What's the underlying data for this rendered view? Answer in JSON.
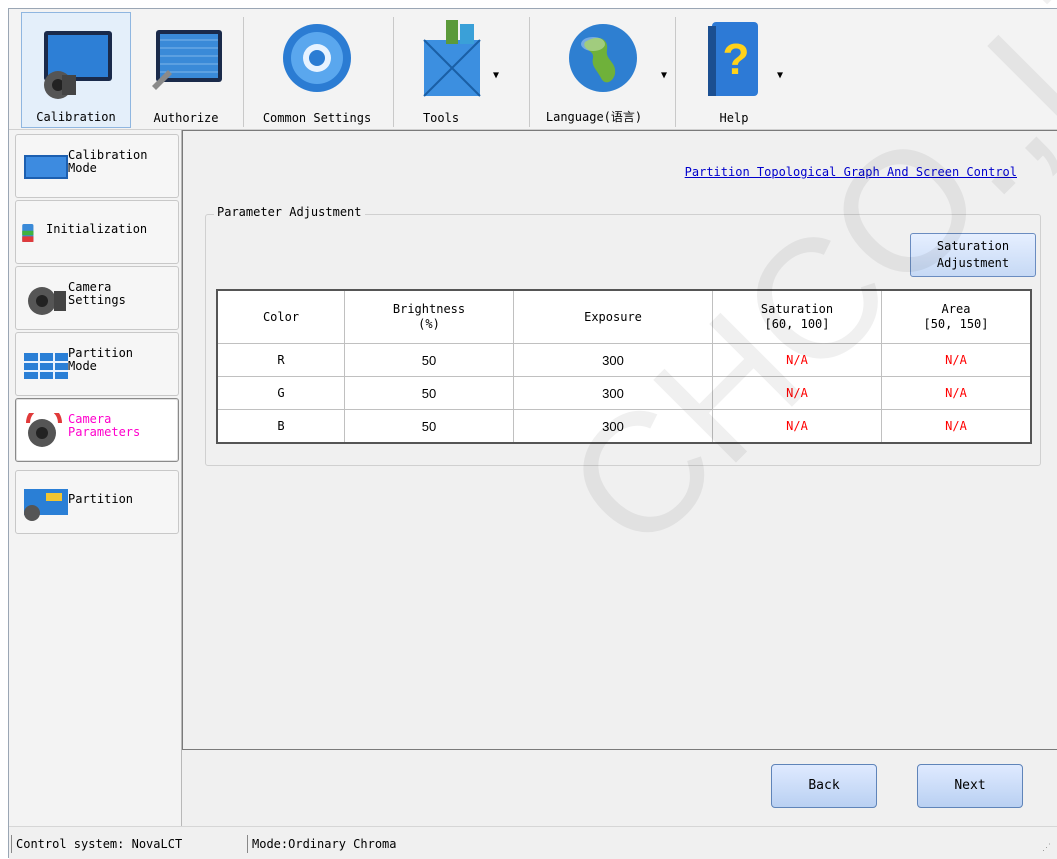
{
  "toolbar": {
    "items": [
      {
        "label": "Calibration",
        "icon": "camera-monitor-icon"
      },
      {
        "label": "Authorize",
        "icon": "monitor-wrench-icon"
      },
      {
        "label": "Common Settings",
        "icon": "gear-icon"
      },
      {
        "label": "Tools",
        "icon": "toolbox-icon"
      },
      {
        "label": "Language(语言)",
        "icon": "globe-icon"
      },
      {
        "label": "Help",
        "icon": "help-book-icon"
      }
    ]
  },
  "sidebar": {
    "items": [
      {
        "label": "Calibration\nMode"
      },
      {
        "label": "Initialization"
      },
      {
        "label": "Camera\nSettings"
      },
      {
        "label": "Partition\nMode"
      },
      {
        "label": "Camera\nParameters"
      },
      {
        "label": "Partition"
      }
    ]
  },
  "main": {
    "topology_link": "Partition Topological Graph And Screen Control",
    "group_title": "Parameter Adjustment",
    "saturation_button": "Saturation\nAdjustment",
    "table": {
      "headers": [
        "Color",
        "Brightness\n(%)",
        "Exposure",
        "Saturation\n[60, 100]",
        "Area\n[50, 150]"
      ],
      "rows": [
        [
          "R",
          "50",
          "300",
          "N/A",
          "N/A"
        ],
        [
          "G",
          "50",
          "300",
          "N/A",
          "N/A"
        ],
        [
          "B",
          "50",
          "300",
          "N/A",
          "N/A"
        ]
      ]
    },
    "back": "Back",
    "next": "Next"
  },
  "status": {
    "control": "Control system: NovaLCT",
    "mode": "Mode:Ordinary Chroma"
  },
  "watermark": "CHCO.,LTD",
  "colors": {
    "accent": "#8fb6e0",
    "na": "#ff0000",
    "link": "#0000cc",
    "active_nav": "#ff00cc"
  }
}
